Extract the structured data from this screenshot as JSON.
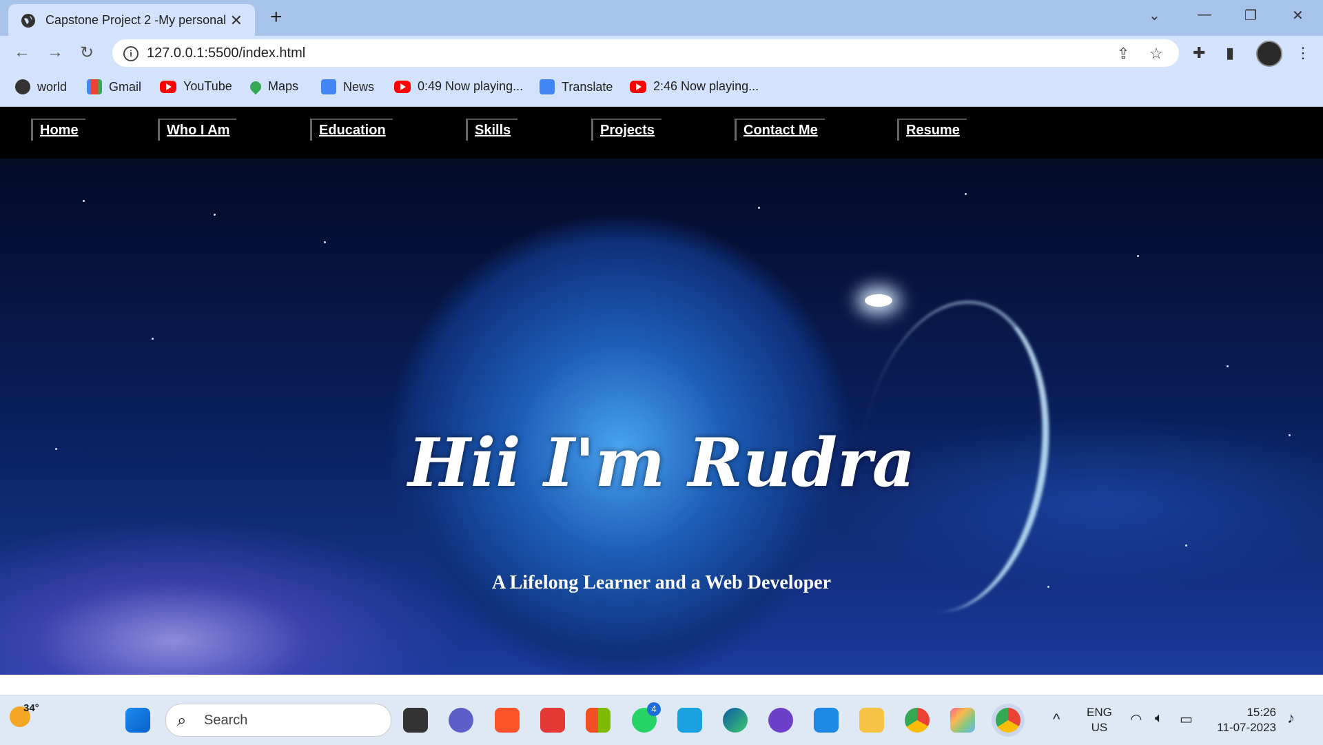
{
  "browser": {
    "tab_title": "Capstone Project 2 -My personal",
    "url": "127.0.0.1:5500/index.html",
    "bookmarks": [
      {
        "label": "world"
      },
      {
        "label": "Gmail"
      },
      {
        "label": "YouTube"
      },
      {
        "label": "Maps"
      },
      {
        "label": "News"
      },
      {
        "label": "0:49 Now playing..."
      },
      {
        "label": "Translate"
      },
      {
        "label": "2:46 Now playing..."
      }
    ]
  },
  "site": {
    "nav": [
      "Home",
      "Who I Am",
      "Education",
      "Skills",
      "Projects",
      "Contact Me",
      "Resume"
    ],
    "hero_title": "Hii I'm Rudra",
    "hero_subtitle": "A Lifelong Learner and a Web Developer"
  },
  "taskbar": {
    "weather": "34°",
    "search_placeholder": "Search",
    "whatsapp_badge": "4",
    "lang_top": "ENG",
    "lang_bottom": "US",
    "time": "15:26",
    "date": "11-07-2023"
  },
  "colors": {
    "nav_bg": "#000000",
    "chrome_accent": "#d3e3fd"
  }
}
